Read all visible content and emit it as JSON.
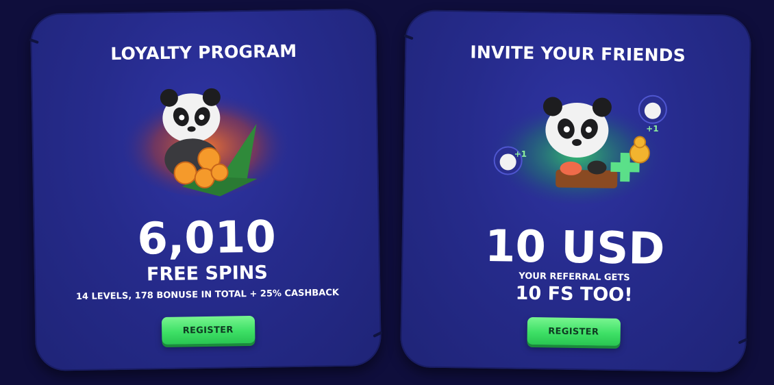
{
  "cards": [
    {
      "title": "LOYALTY PROGRAM",
      "amount": "6,010",
      "unit": "FREE SPINS",
      "details": "14 LEVELS, 178 BONUSE IN TOTAL + 25% CASHBACK",
      "button": "REGISTER"
    },
    {
      "title": "INVITE YOUR FRIENDS",
      "amount": "10 USD",
      "subtitle": "YOUR REFERRAL GETS",
      "bonus": "10 FS TOO!",
      "button": "REGISTER",
      "badges": [
        "+1",
        "+1"
      ]
    }
  ],
  "colors": {
    "background": "#0f0e3c",
    "card": "#262b8c",
    "button": "#3ee066",
    "button_text": "#0f3a22"
  }
}
